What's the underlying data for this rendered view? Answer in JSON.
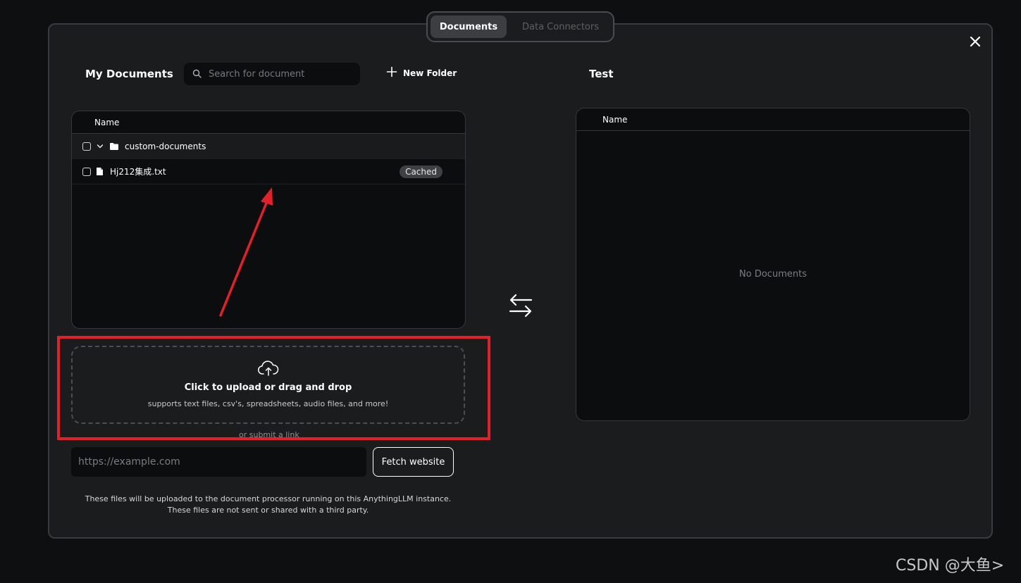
{
  "tabs": [
    {
      "label": "Documents",
      "active": true
    },
    {
      "label": "Data Connectors",
      "active": false
    }
  ],
  "left": {
    "title": "My Documents",
    "search_placeholder": "Search for document",
    "new_folder_label": "New Folder",
    "table": {
      "header": "Name",
      "folder": {
        "name": "custom-documents"
      },
      "files": [
        {
          "name": "Hj212集成.txt",
          "badge": "Cached"
        }
      ]
    }
  },
  "upload": {
    "title": "Click to upload or drag and drop",
    "subtitle": "supports text files, csv's, spreadsheets, audio files, and more!",
    "or_link": "or submit a link"
  },
  "link": {
    "placeholder": "https://example.com",
    "fetch_label": "Fetch website"
  },
  "disclaimer": {
    "line1": "These files will be uploaded to the document processor running on this AnythingLLM instance.",
    "line2": "These files are not sent or shared with a third party."
  },
  "right": {
    "title": "Test",
    "table": {
      "header": "Name",
      "empty_text": "No Documents"
    }
  },
  "watermark": "CSDN @大鱼>",
  "colors": {
    "background": "#0e0f10",
    "modal": "#1b1c1e",
    "annotation_red": "#e3202a"
  }
}
